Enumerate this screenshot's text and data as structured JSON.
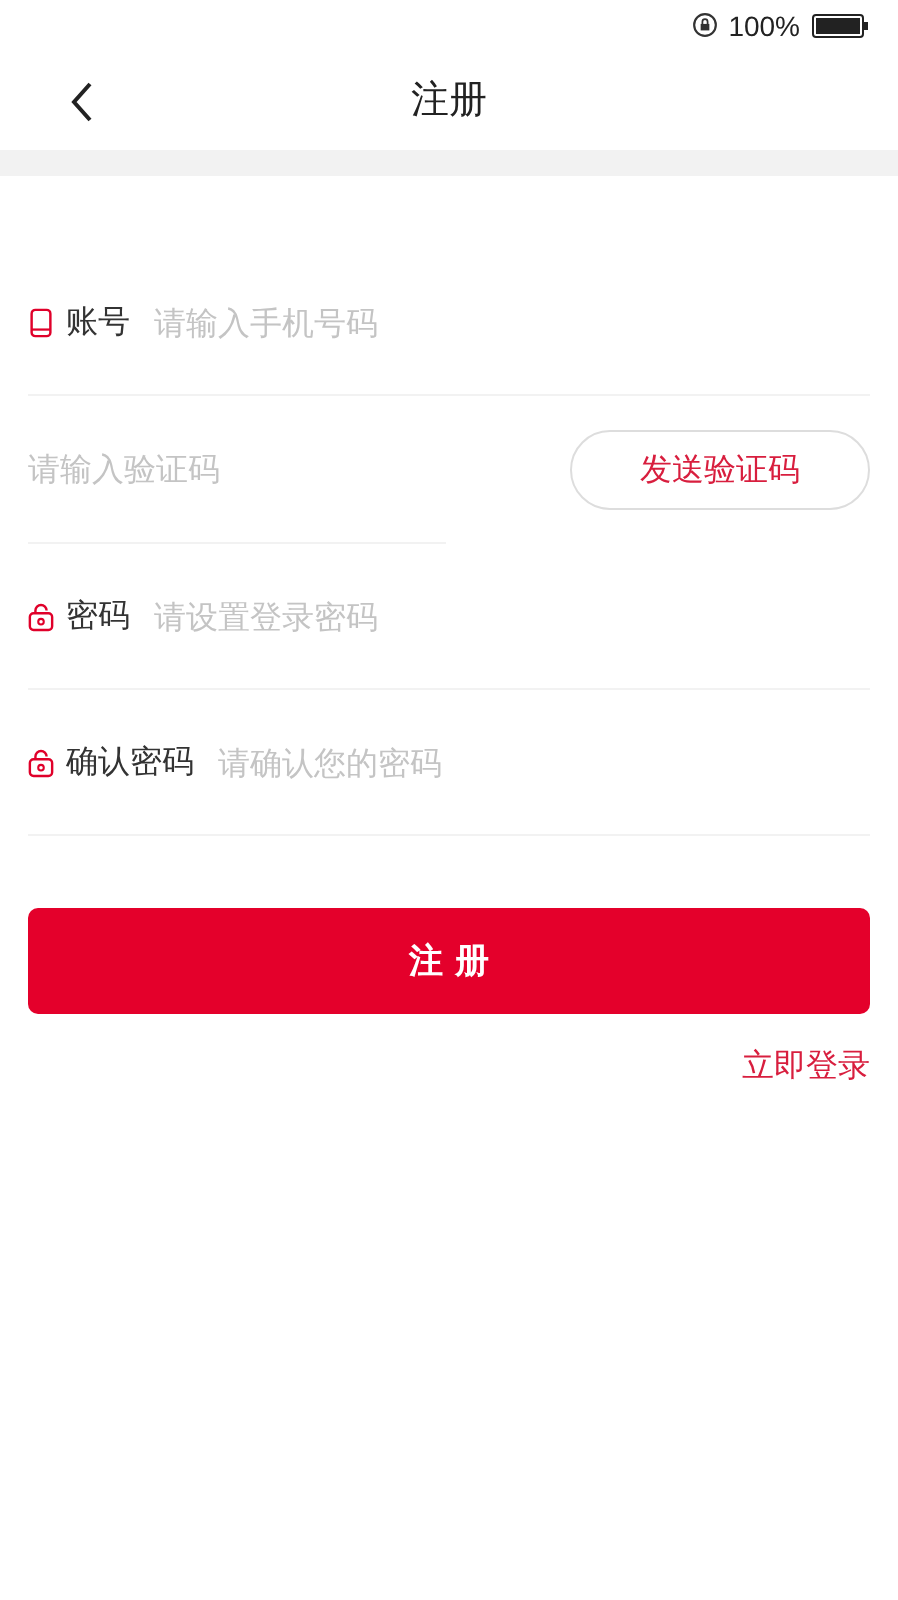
{
  "status_bar": {
    "battery": "100%"
  },
  "nav": {
    "title": "注册"
  },
  "fields": [
    {
      "kind": "account",
      "label": "账号",
      "placeholder": "请输入手机号码"
    },
    {
      "kind": "code",
      "placeholder": "请输入验证码",
      "button": "发送验证码"
    },
    {
      "kind": "password",
      "label": "密码",
      "placeholder": "请设置登录密码"
    },
    {
      "kind": "password",
      "label": "确认密码",
      "placeholder": "请确认您的密码"
    }
  ],
  "submit": "注 册",
  "login_link": "立即登录"
}
